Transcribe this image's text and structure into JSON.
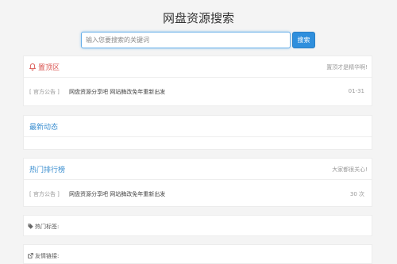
{
  "header": {
    "title": "网盘资源搜索"
  },
  "search": {
    "placeholder": "输入您要搜索的关键词",
    "button_label": "搜索"
  },
  "pinned": {
    "title": "置顶区",
    "subtitle": "置顶才是精华啊!",
    "items": [
      {
        "tag": "[ 官方公告 ]",
        "text": "网盘资源分享吧 网站酶改免年重新出发",
        "date": "01-31"
      }
    ]
  },
  "latest": {
    "title": "最新动态"
  },
  "hot": {
    "title": "热门排行榜",
    "subtitle": "大家都很关心!",
    "items": [
      {
        "tag": "[ 官方公告 ]",
        "text": "网盘资源分享吧 网站酶改免年重新出发",
        "count": "30 次"
      }
    ]
  },
  "tags_section": {
    "label": "热门标签:"
  },
  "links_section": {
    "label": "友情链接:"
  },
  "colors": {
    "accent_blue": "#3a8ed0",
    "accent_red": "#d9534f",
    "button": "#2f8fdd"
  },
  "icons": {
    "pinned": "bell-icon",
    "tags": "tag-icon",
    "links": "external-link-icon"
  }
}
